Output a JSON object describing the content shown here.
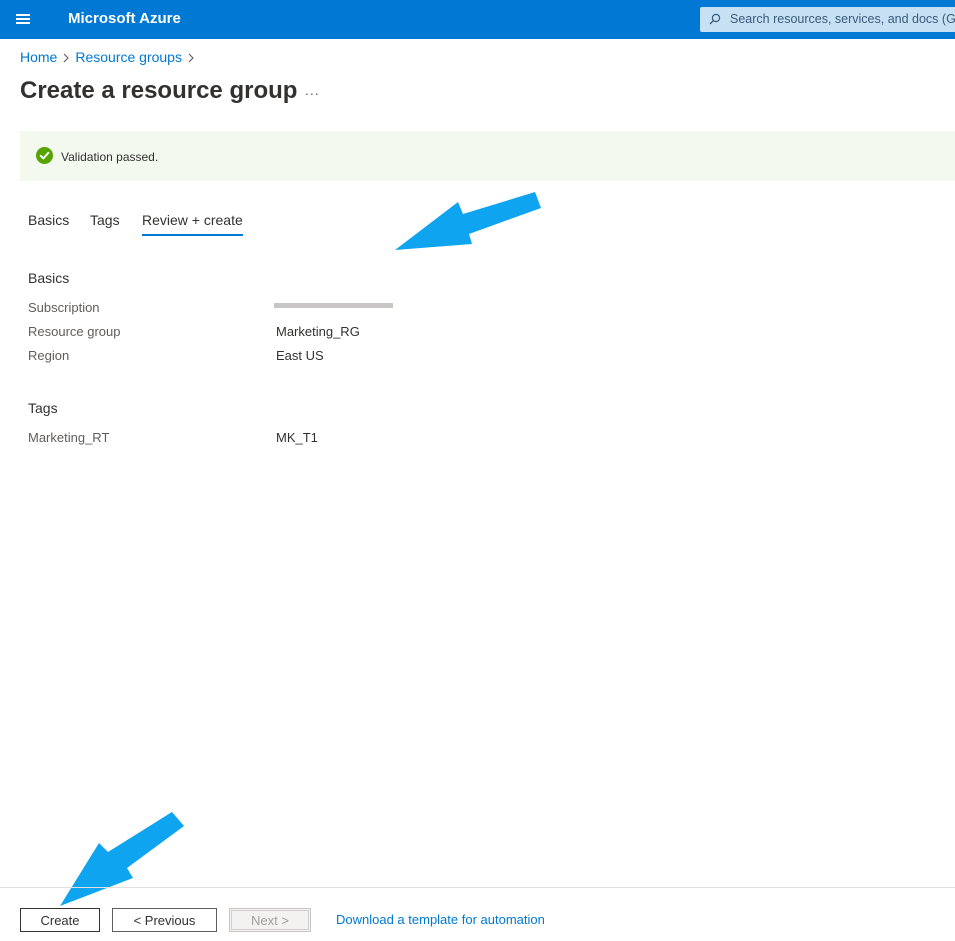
{
  "header": {
    "brand": "Microsoft Azure",
    "search_placeholder": "Search resources, services, and docs (G+/)"
  },
  "breadcrumb": {
    "items": [
      "Home",
      "Resource groups"
    ]
  },
  "page": {
    "title": "Create a resource group",
    "more": "..."
  },
  "banner": {
    "text": "Validation passed."
  },
  "tabs": [
    {
      "label": "Basics",
      "active": false
    },
    {
      "label": "Tags",
      "active": false
    },
    {
      "label": "Review + create",
      "active": true
    }
  ],
  "basics": {
    "title": "Basics",
    "rows": [
      {
        "label": "Subscription",
        "value": ""
      },
      {
        "label": "Resource group",
        "value": "Marketing_RG"
      },
      {
        "label": "Region",
        "value": "East US"
      }
    ]
  },
  "tags": {
    "title": "Tags",
    "rows": [
      {
        "label": "Marketing_RT",
        "value": "MK_T1"
      }
    ]
  },
  "footer": {
    "create_label": "Create",
    "previous_label": "< Previous",
    "next_label": "Next >",
    "link_label": "Download a template for automation"
  },
  "colors": {
    "header_bg": "#0078d4",
    "accent": "#0078d4",
    "success": "#57a300",
    "annotation_arrow": "#0ea4ef"
  }
}
